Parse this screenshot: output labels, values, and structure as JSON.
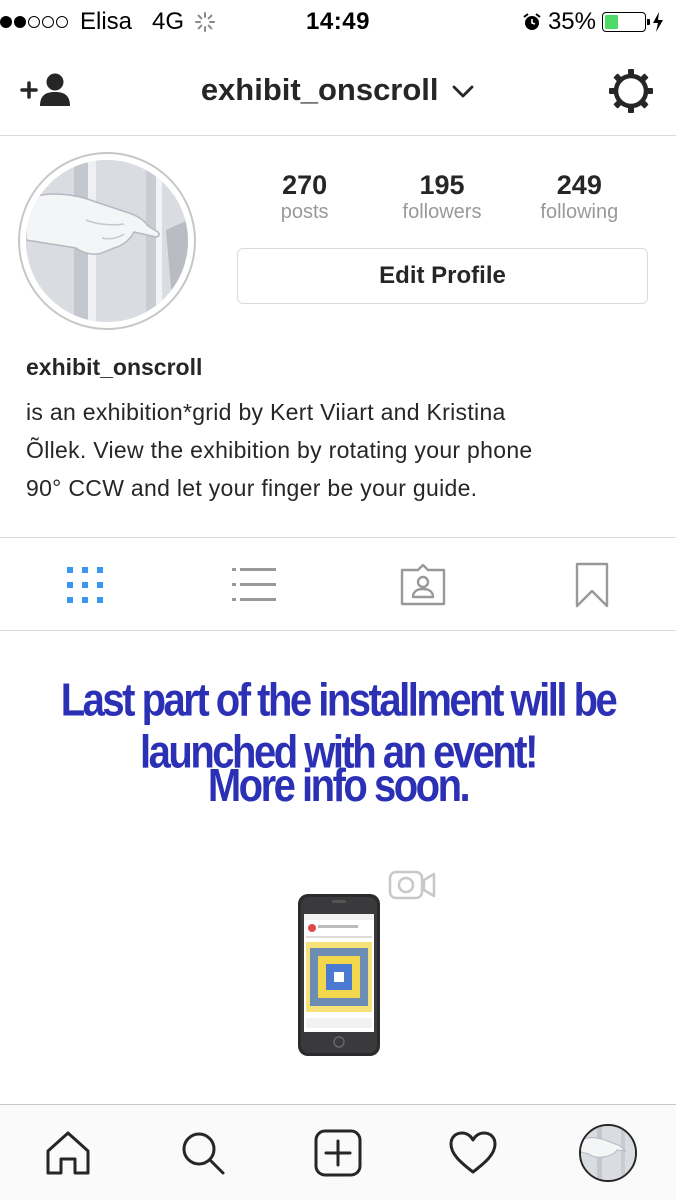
{
  "status_bar": {
    "carrier": "Elisa",
    "network": "4G",
    "time": "14:49",
    "battery": "35%",
    "battery_level": 0.35
  },
  "header": {
    "username": "exhibit_onscroll",
    "add_person_icon": "add-person-icon",
    "options_icon": "gear-icon"
  },
  "profile": {
    "stats": [
      {
        "value": "270",
        "label": "posts"
      },
      {
        "value": "195",
        "label": "followers"
      },
      {
        "value": "249",
        "label": "following"
      }
    ],
    "edit_label": "Edit Profile",
    "name": "exhibit_onscroll",
    "bio_lines": [
      "is an exhibition*grid by Kert Viiart and Kristina",
      "Õllek. View the exhibition by rotating your phone",
      "90° CCW and let your finger be your guide."
    ]
  },
  "tabs": [
    {
      "name": "grid",
      "active": true
    },
    {
      "name": "list",
      "active": false
    },
    {
      "name": "tagged",
      "active": false
    },
    {
      "name": "saved",
      "active": false
    }
  ],
  "post": {
    "line1": "Last part of the installment will be launched with an event!",
    "line2": "More info soon."
  },
  "colors": {
    "accent": "#3897f0",
    "text": "#262626",
    "muted": "#999999",
    "announcement": "#2b30b5"
  }
}
